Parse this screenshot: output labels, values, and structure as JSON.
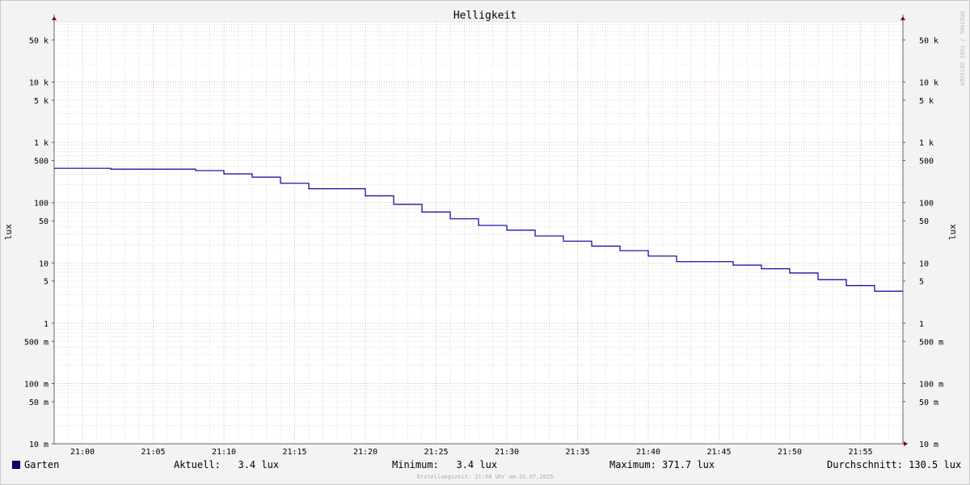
{
  "chart_data": {
    "type": "line",
    "title": "Helligkeit",
    "ylabel": "lux",
    "y_scale": "log",
    "ylim": [
      0.01,
      100000
    ],
    "xlim": [
      "20:58",
      "21:58"
    ],
    "x_ticks": [
      "21:00",
      "21:05",
      "21:10",
      "21:15",
      "21:20",
      "21:25",
      "21:30",
      "21:35",
      "21:40",
      "21:45",
      "21:50",
      "21:55"
    ],
    "y_ticks": [
      {
        "value": 50000,
        "label": "50 k"
      },
      {
        "value": 10000,
        "label": "10 k"
      },
      {
        "value": 5000,
        "label": "5 k"
      },
      {
        "value": 1000,
        "label": "1 k"
      },
      {
        "value": 500,
        "label": "500"
      },
      {
        "value": 100,
        "label": "100"
      },
      {
        "value": 50,
        "label": "50"
      },
      {
        "value": 10,
        "label": "10"
      },
      {
        "value": 5,
        "label": "5"
      },
      {
        "value": 1,
        "label": "1"
      },
      {
        "value": 0.5,
        "label": "500 m"
      },
      {
        "value": 0.1,
        "label": "100 m"
      },
      {
        "value": 0.05,
        "label": "50 m"
      },
      {
        "value": 0.01,
        "label": "10 m"
      }
    ],
    "grid": true,
    "legend_position": "bottom-left",
    "series": [
      {
        "name": "Garten",
        "color": "#0000a0",
        "step": true,
        "x": [
          "20:58",
          "21:02",
          "21:08",
          "21:10",
          "21:12",
          "21:14",
          "21:16",
          "21:20",
          "21:22",
          "21:24",
          "21:26",
          "21:28",
          "21:30",
          "21:32",
          "21:34",
          "21:36",
          "21:38",
          "21:40",
          "21:42",
          "21:46",
          "21:48",
          "21:50",
          "21:52",
          "21:54",
          "21:56",
          "21:58"
        ],
        "values": [
          371.7,
          360,
          340,
          300,
          265,
          210,
          170,
          130,
          94,
          70,
          54,
          42,
          35,
          28,
          23,
          19,
          16,
          13,
          10.5,
          9.2,
          8,
          6.8,
          5.3,
          4.2,
          3.4,
          3.4
        ]
      }
    ]
  },
  "legend": {
    "series_name": "Garten",
    "current": "Aktuell:   3.4 lux",
    "minimum": "Minimum:   3.4 lux",
    "maximum": "Maximum: 371.7 lux",
    "average": "Durchschnitt: 130.5 lux"
  },
  "footer": "Erstellungszeit: 21:58 Uhr am 21.07.2025",
  "watermark": "RRDTOOL / TOBI OETIKER",
  "colors": {
    "background": "#f3f3f3",
    "plot_background": "#ffffff",
    "major_grid": "#e8a0a0",
    "minor_grid": "#c8c8c8",
    "line": "#0000a0",
    "axis_arrow": "#8b0000"
  }
}
